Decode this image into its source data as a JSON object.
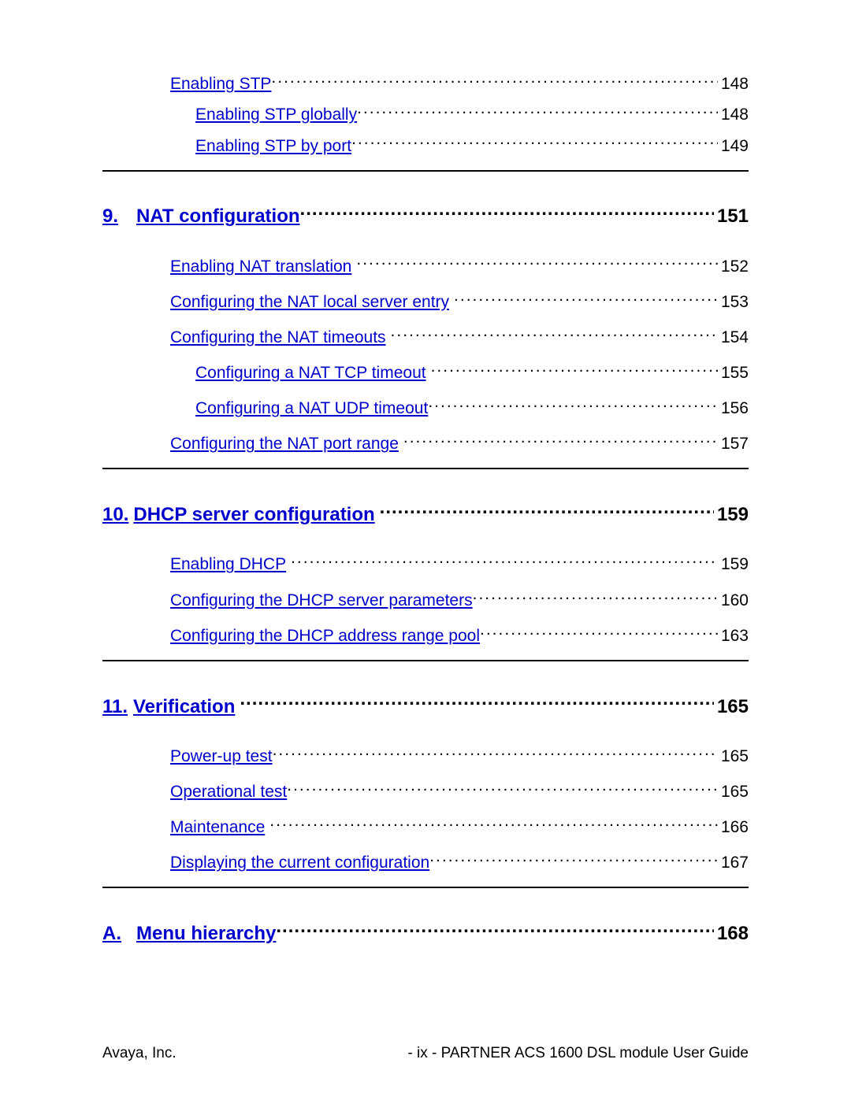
{
  "initial_entries": [
    {
      "level": 1,
      "label": "Enabling STP",
      "page": "148"
    },
    {
      "level": 2,
      "label": "Enabling STP globally",
      "page": "148"
    },
    {
      "level": 2,
      "label": "Enabling STP by port",
      "page": "149"
    }
  ],
  "chapters": [
    {
      "num": "9.",
      "title": "NAT configuration",
      "page": "151",
      "entries": [
        {
          "level": 1,
          "label": "Enabling NAT translation",
          "page": "152"
        },
        {
          "level": 1,
          "label": "Configuring the NAT local server entry",
          "page": "153"
        },
        {
          "level": 1,
          "label": "Configuring the NAT timeouts",
          "page": "154"
        },
        {
          "level": 2,
          "label": "Configuring a NAT TCP timeout",
          "page": "155"
        },
        {
          "level": 2,
          "label": "Configuring a NAT UDP timeout",
          "page": "156"
        },
        {
          "level": 1,
          "label": "Configuring the NAT port range",
          "page": "157"
        }
      ]
    },
    {
      "num": "10.",
      "title": "DHCP server configuration",
      "page": "159",
      "entries": [
        {
          "level": 1,
          "label": "Enabling DHCP",
          "page": "159"
        },
        {
          "level": 1,
          "label": "Configuring the DHCP server parameters",
          "page": "160"
        },
        {
          "level": 1,
          "label": "Configuring the DHCP address range pool",
          "page": "163"
        }
      ]
    },
    {
      "num": "11.",
      "title": "Verification",
      "page": "165",
      "entries": [
        {
          "level": 1,
          "label": "Power-up test",
          "page": "165"
        },
        {
          "level": 1,
          "label": "Operational test",
          "page": "165"
        },
        {
          "level": 1,
          "label": "Maintenance",
          "page": "166"
        },
        {
          "level": 1,
          "label": "Displaying the current configuration",
          "page": "167"
        }
      ]
    },
    {
      "num": "A.",
      "title": "Menu hierarchy",
      "page": "168",
      "entries": []
    }
  ],
  "footer": {
    "left": "Avaya, Inc.",
    "right": "- ix -   PARTNER ACS 1600 DSL module User Guide"
  }
}
